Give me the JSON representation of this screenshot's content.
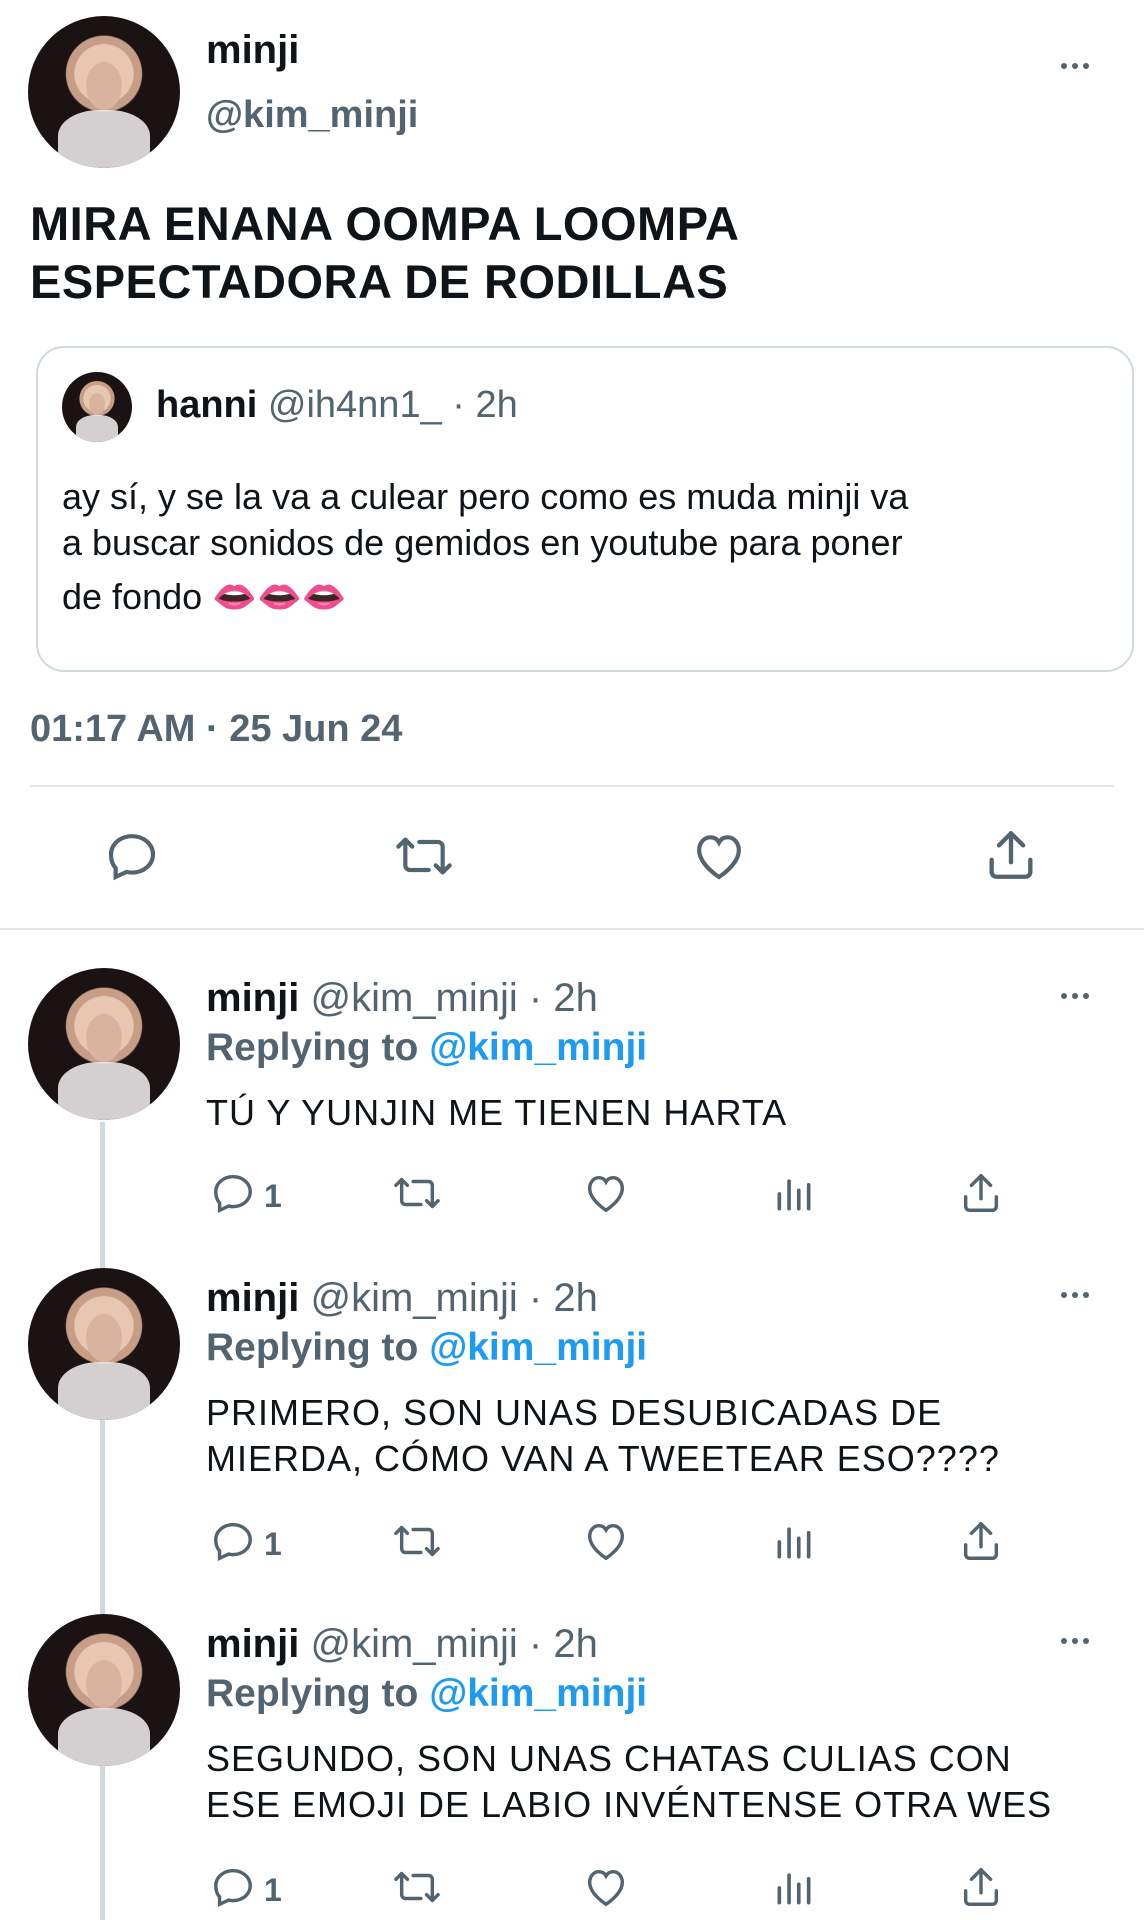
{
  "main_tweet": {
    "display_name": "minji",
    "handle": "@kim_minji",
    "text_line1": "MIRA ENANA OOMPA LOOMPA",
    "text_line2": "ESPECTADORA DE RODILLAS",
    "timestamp": "01:17 AM · 25 Jun 24"
  },
  "quoted_tweet": {
    "display_name": "hanni",
    "handle": "@ih4nn1_",
    "time": "· 2h",
    "text_line1": "ay sí, y se la va a culear pero como es muda minji va",
    "text_line2": "a buscar sonidos de gemidos en youtube para poner",
    "text_line3": "de fondo 👄👄👄"
  },
  "replies": [
    {
      "display_name": "minji",
      "handle": "@kim_minji",
      "time": "· 2h",
      "replying_label": "Replying to",
      "replying_handle": "@kim_minji",
      "text_line1": "TÚ Y YUNJIN ME TIENEN HARTA",
      "text_line2": "",
      "reply_count": "1"
    },
    {
      "display_name": "minji",
      "handle": "@kim_minji",
      "time": "· 2h",
      "replying_label": "Replying to",
      "replying_handle": "@kim_minji",
      "text_line1": "PRIMERO, SON UNAS DESUBICADAS DE",
      "text_line2": "MIERDA, CÓMO VAN A TWEETEAR ESO????",
      "reply_count": "1"
    },
    {
      "display_name": "minji",
      "handle": "@kim_minji",
      "time": "· 2h",
      "replying_label": "Replying to",
      "replying_handle": "@kim_minji",
      "text_line1": "SEGUNDO, SON UNAS CHATAS CULIAS CON",
      "text_line2": "ESE EMOJI DE LABIO INVÉNTENSE OTRA WES",
      "reply_count": "1"
    }
  ],
  "icons": {
    "reply": "reply-icon",
    "retweet": "retweet-icon",
    "like": "heart-icon",
    "share": "share-icon",
    "analytics": "analytics-icon",
    "more": "more-icon"
  },
  "colors": {
    "text": "#0f1419",
    "secondary": "#536471",
    "link": "#1d9bf0",
    "divider": "#cfd9de"
  }
}
